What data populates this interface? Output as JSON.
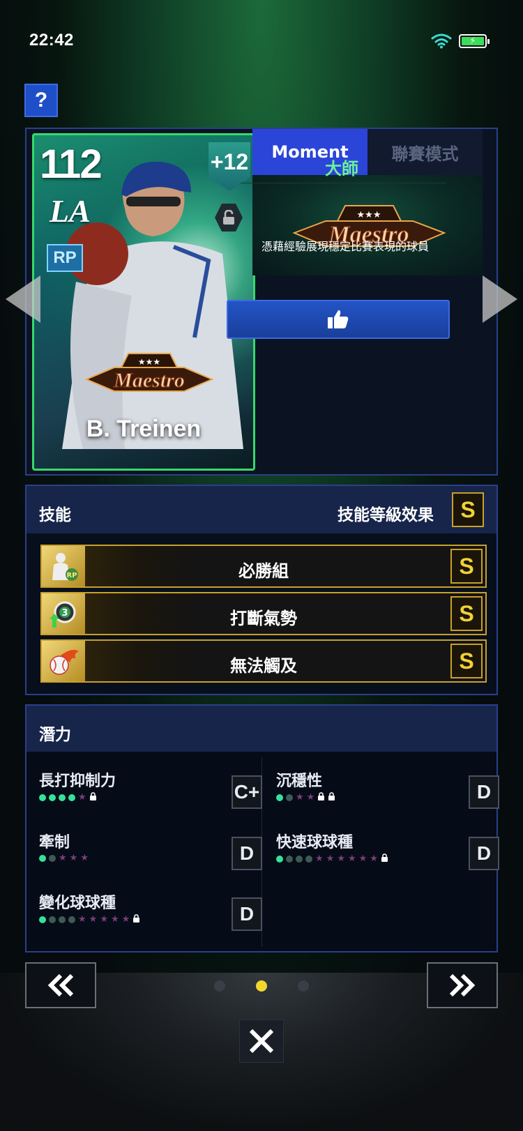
{
  "status_bar": {
    "time": "22:42"
  },
  "help_label": "?",
  "card": {
    "rating": "112",
    "team": "LA",
    "position": "RP",
    "boost": "+12",
    "player_name": "B. Treinen",
    "badge_text": "Maestro"
  },
  "tabs": [
    {
      "label": "Moment",
      "active": true
    },
    {
      "label": "聯賽模式",
      "active": false
    }
  ],
  "moment": {
    "badge_text": "Maestro",
    "title": "大師",
    "description": "憑藉經驗展現穩定比賽表現的球員"
  },
  "skills": {
    "header_title": "技能",
    "header_right": "技能等級效果",
    "header_grade": "S",
    "items": [
      {
        "name": "必勝組",
        "grade": "S",
        "icon": "relief-pitcher-icon"
      },
      {
        "name": "打斷氣勢",
        "grade": "S",
        "icon": "momentum-break-icon"
      },
      {
        "name": "無法觸及",
        "grade": "S",
        "icon": "fireball-icon"
      }
    ]
  },
  "potential": {
    "header_title": "潛力",
    "items": [
      {
        "name": "長打抑制力",
        "grade": "C+",
        "filled": 4,
        "empty_dots": 0,
        "stars": 1,
        "locks": 1
      },
      {
        "name": "沉穩性",
        "grade": "D",
        "filled": 1,
        "empty_dots": 1,
        "stars": 2,
        "locks": 2
      },
      {
        "name": "牽制",
        "grade": "D",
        "filled": 1,
        "empty_dots": 1,
        "stars": 3,
        "locks": 0
      },
      {
        "name": "快速球球種",
        "grade": "D",
        "filled": 1,
        "empty_dots": 3,
        "stars": 6,
        "locks": 1
      },
      {
        "name": "變化球球種",
        "grade": "D",
        "filled": 1,
        "empty_dots": 3,
        "stars": 5,
        "locks": 1
      }
    ]
  },
  "pager": {
    "pages": 3,
    "current": 2
  },
  "colors": {
    "accent_blue": "#2b45d9",
    "gold": "#c9a02a",
    "grade_yellow": "#f2d136",
    "moment_green": "#6cf29a"
  }
}
